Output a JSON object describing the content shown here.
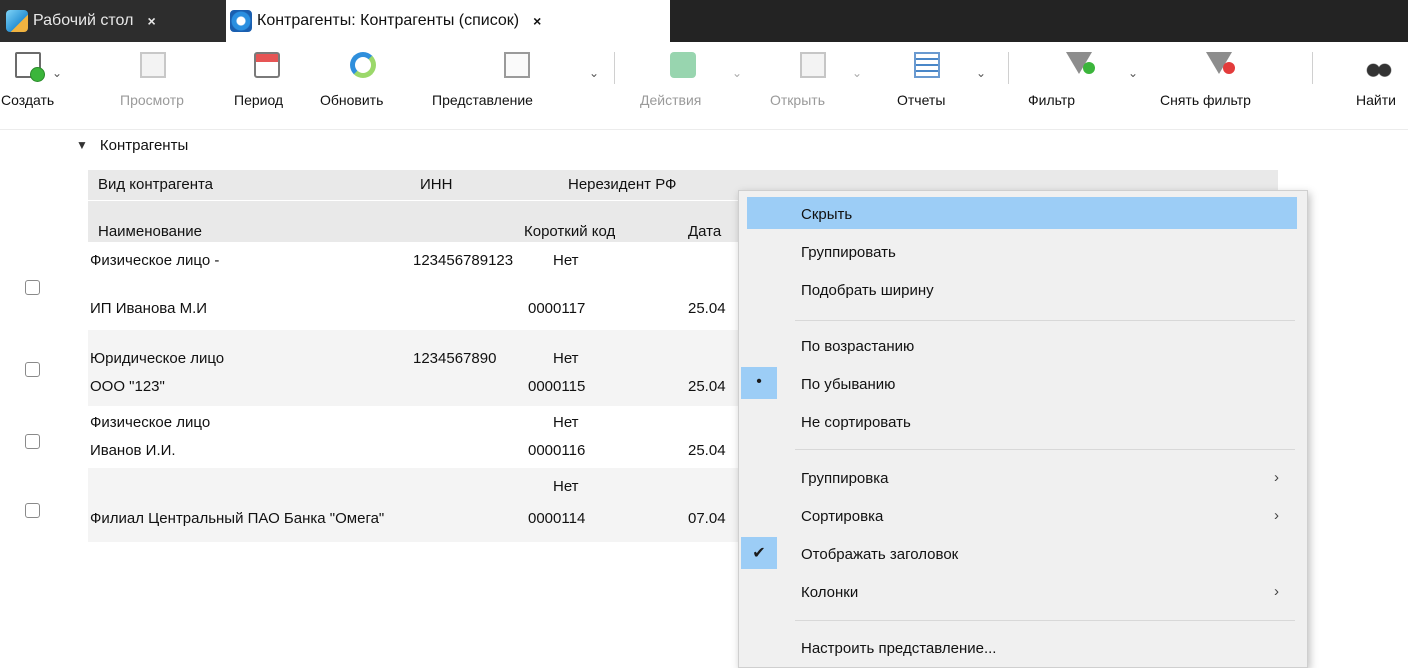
{
  "tabs": [
    {
      "label": "Рабочий стол",
      "close": "×",
      "active": false
    },
    {
      "label": "Контрагенты: Контрагенты (список)",
      "close": "×",
      "active": true
    }
  ],
  "toolbar": {
    "create": "Создать",
    "view": "Просмотр",
    "period": "Период",
    "refresh": "Обновить",
    "presentation": "Представление",
    "actions": "Действия",
    "open": "Открыть",
    "reports": "Отчеты",
    "filter": "Фильтр",
    "remove_filter": "Снять фильтр",
    "find": "Найти",
    "dropdown_glyph": "⌄"
  },
  "grid": {
    "group_label": "Контрагенты",
    "header1": {
      "type": "Вид контрагента",
      "inn": "ИНН",
      "nonresident": "Нерезидент РФ"
    },
    "header2": {
      "name": "Наименование",
      "short_code": "Короткий код",
      "date": "Дата"
    },
    "records": [
      {
        "type": "Физическое лицо -",
        "inn": "123456789123",
        "nonresident": "Нет",
        "name": "ИП Иванова М.И",
        "code": "0000117",
        "date": "25.04"
      },
      {
        "type": "Юридическое лицо",
        "inn": "1234567890",
        "nonresident": "Нет",
        "name": "ООО \"123\"",
        "code": "0000115",
        "date": "25.04"
      },
      {
        "type": "Физическое лицо",
        "inn": "",
        "nonresident": "Нет",
        "name": "Иванов И.И.",
        "code": "0000116",
        "date": "25.04"
      },
      {
        "type": "",
        "inn": "",
        "nonresident": "Нет",
        "name": "Филиал Центральный ПАО Банка \"Омега\"",
        "code": "0000114",
        "date": "07.04"
      }
    ]
  },
  "context_menu": {
    "hide": "Скрыть",
    "group": "Группировать",
    "fit_width": "Подобрать ширину",
    "sort_asc": "По возрастанию",
    "sort_desc": "По убыванию",
    "no_sort": "Не сортировать",
    "grouping": "Группировка",
    "sorting": "Сортировка",
    "show_header": "Отображать заголовок",
    "columns": "Колонки",
    "customize": "Настроить представление...",
    "bullet": "•",
    "check": "✔",
    "submenu_arrow": "›",
    "highlight_color": "#9ccdf6"
  }
}
